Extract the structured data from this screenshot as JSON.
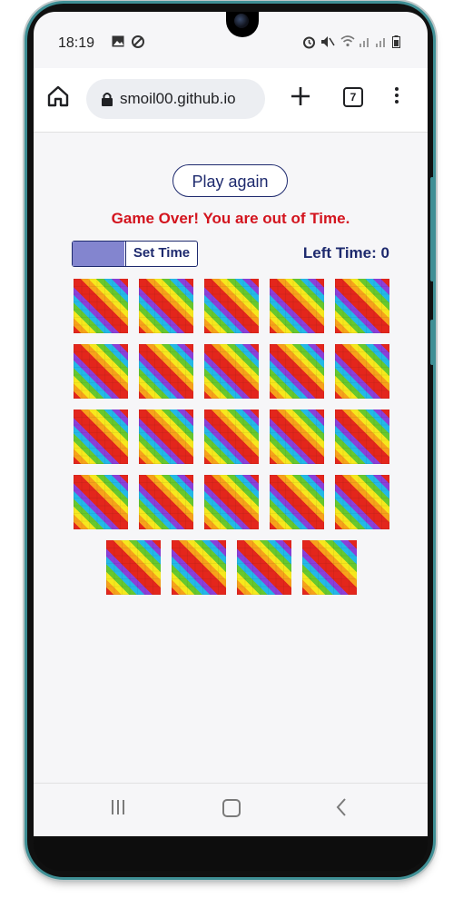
{
  "status_bar": {
    "time": "18:19",
    "left_icons": [
      "image-icon",
      "data-saver-icon"
    ],
    "right_icons": [
      "alarm-icon",
      "mute-icon",
      "wifi-icon",
      "signal-icon",
      "signal-icon",
      "battery-icon"
    ]
  },
  "browser": {
    "url": "smoil00.github.io",
    "tab_count": "7",
    "icons": [
      "home-icon",
      "lock-icon",
      "plus-icon",
      "menu-icon"
    ]
  },
  "game": {
    "play_again_label": "Play again",
    "game_over_message": "Game Over! You are out of Time.",
    "set_time_label": "Set Time",
    "timer_progress": 0.42,
    "left_time_label": "Left Time:",
    "left_time_value": "0",
    "card_count": 24,
    "rows": [
      5,
      5,
      5,
      5,
      4
    ]
  },
  "nav_bar": {
    "icons": [
      "recent-apps-icon",
      "home-icon",
      "back-icon"
    ]
  },
  "colors": {
    "accent": "#1e2a6e",
    "game_over_red": "#d3141e",
    "timer_fill": "#8385cf",
    "frame_teal": "#3f8f95"
  }
}
